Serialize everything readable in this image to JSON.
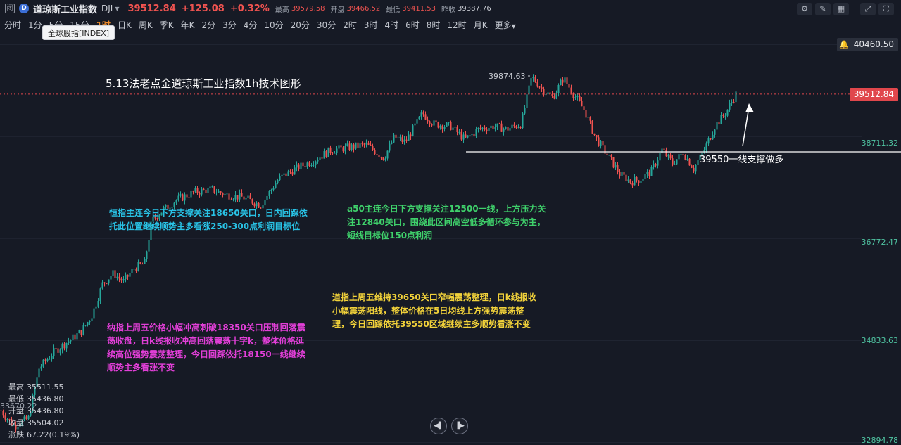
{
  "header": {
    "window_icon": "闭",
    "logo_text": "D",
    "symbol_name": "道琼斯工业指数",
    "symbol_code": "DJI",
    "price": "39512.84",
    "change": "+125.08",
    "change_pct": "+0.32%",
    "quotes": [
      {
        "label": "最高",
        "value": "39579.58",
        "tone": "red"
      },
      {
        "label": "开盘",
        "value": "39466.52",
        "tone": "red"
      },
      {
        "label": "最低",
        "value": "39411.53",
        "tone": "red"
      },
      {
        "label": "昨收",
        "value": "39387.76",
        "tone": "grey"
      }
    ],
    "toolbar_icons": [
      "chart-settings-icon",
      "edit-icon",
      "layout-icon",
      "expand-icon",
      "fullscreen-icon"
    ]
  },
  "timeframes": {
    "items": [
      "分时",
      "1分",
      "5分",
      "15分",
      "1时",
      "日K",
      "周K",
      "季K",
      "年K",
      "2分",
      "3分",
      "4分",
      "10分",
      "20分",
      "30分",
      "2时",
      "3时",
      "4时",
      "6时",
      "8时",
      "12时",
      "月K"
    ],
    "active_index": 4,
    "more_label": "更多",
    "tooltip": "全球股指[INDEX]"
  },
  "axis": {
    "top_value": "40460.50",
    "current_price": "39512.84",
    "ticks": [
      "38711.32",
      "36772.47",
      "34833.63",
      "32894.78"
    ]
  },
  "annotations": {
    "title": "5.13法老点金道琼斯工业指数1h技术图形",
    "peak_label": "39874.63",
    "support_note": "39550一线支撑做多",
    "hangseng": "恒指主连今日下方支撑关注18650关口，日内回踩依托此位置继续顺势主多看涨250-300点利润目标位",
    "a50": "a50主连今日下方支撑关注12500一线，上方压力关注12840关口，围绕此区间高空低多循环参与为主，短线目标位150点利润",
    "dow": "道指上周五维持39650关口窄幅震荡整理，日k线报收小幅震荡阳线，整体价格在5日均线上方强势震荡整理，今日回踩依托39550区域继续主多顺势看涨不变",
    "nasdaq": "纳指上周五价格小幅冲高刺破18350关口压制回落震荡收盘，日k线报收冲高回落震荡十字k，整体价格延续高位强势震荡整理，今日回踩依托18150一线继续顺势主多看涨不变"
  },
  "ohlc_panel": {
    "rows": [
      {
        "label": "最高",
        "value": "35511.55"
      },
      {
        "label": "最低",
        "value": "35436.80"
      },
      {
        "label": "开盘",
        "value": "35436.80"
      },
      {
        "label": "收盘",
        "value": "35504.02"
      },
      {
        "label": "涨跌",
        "value": "67.22(0.19%)"
      }
    ],
    "crosshair_time": "33670.22"
  },
  "colors": {
    "up": "#26a69a",
    "down": "#ef5350",
    "price_line": "#e0474c",
    "background": "#161a25"
  },
  "chart_data": {
    "type": "candlestick",
    "title": "5.13法老点金道琼斯工业指数1h技术图形",
    "ylim": [
      32894.78,
      40460.5
    ],
    "y_ticks": [
      32894.78,
      34833.63,
      36772.47,
      38711.32,
      40460.5
    ],
    "current_price": 39512.84,
    "period_high": 39874.63,
    "support_level": 39550,
    "price_path": [
      [
        0,
        33500
      ],
      [
        20,
        33200
      ],
      [
        40,
        33350
      ],
      [
        55,
        34300
      ],
      [
        75,
        34600
      ],
      [
        95,
        34800
      ],
      [
        115,
        35000
      ],
      [
        130,
        35300
      ],
      [
        145,
        35900
      ],
      [
        160,
        36100
      ],
      [
        175,
        35950
      ],
      [
        190,
        36200
      ],
      [
        205,
        36300
      ],
      [
        215,
        37100
      ],
      [
        230,
        37300
      ],
      [
        250,
        37500
      ],
      [
        275,
        37650
      ],
      [
        300,
        37700
      ],
      [
        320,
        37600
      ],
      [
        345,
        37550
      ],
      [
        370,
        37400
      ],
      [
        395,
        37900
      ],
      [
        420,
        38100
      ],
      [
        445,
        38250
      ],
      [
        470,
        38450
      ],
      [
        495,
        38500
      ],
      [
        520,
        38550
      ],
      [
        545,
        38300
      ],
      [
        560,
        38700
      ],
      [
        575,
        38600
      ],
      [
        600,
        39150
      ],
      [
        615,
        38950
      ],
      [
        640,
        38900
      ],
      [
        660,
        38650
      ],
      [
        680,
        38850
      ],
      [
        700,
        38900
      ],
      [
        720,
        38850
      ],
      [
        740,
        38950
      ],
      [
        755,
        39850
      ],
      [
        770,
        39600
      ],
      [
        785,
        39450
      ],
      [
        800,
        39820
      ],
      [
        815,
        39500
      ],
      [
        830,
        39200
      ],
      [
        845,
        38700
      ],
      [
        860,
        38400
      ],
      [
        880,
        38000
      ],
      [
        895,
        37850
      ],
      [
        910,
        37900
      ],
      [
        925,
        38050
      ],
      [
        940,
        38450
      ],
      [
        955,
        38200
      ],
      [
        970,
        38400
      ],
      [
        985,
        38100
      ],
      [
        1000,
        38450
      ],
      [
        1015,
        38900
      ],
      [
        1030,
        39150
      ],
      [
        1045,
        39512.84
      ]
    ]
  }
}
